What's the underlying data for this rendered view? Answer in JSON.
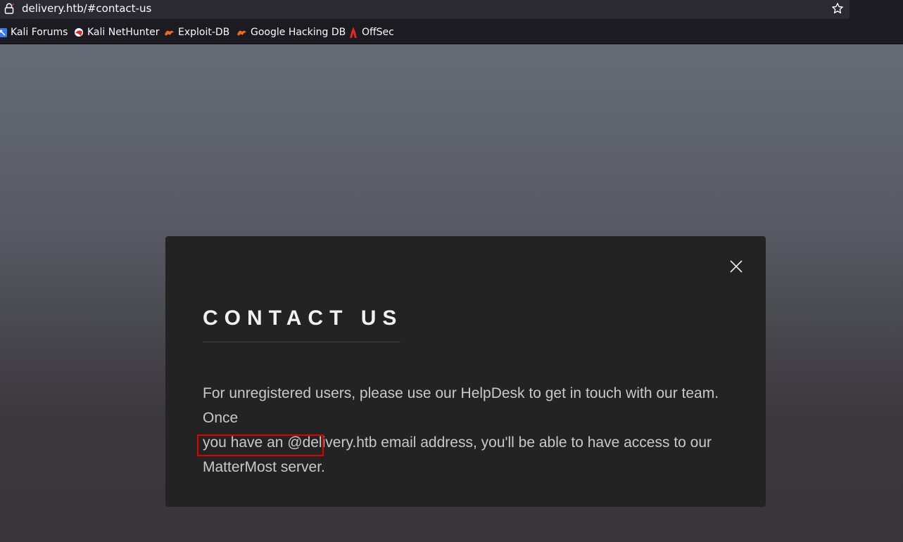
{
  "browser": {
    "url": "delivery.htb/#contact-us",
    "bookmarks": [
      {
        "label": "Kali Forums",
        "icon": "kali-forums-icon"
      },
      {
        "label": "Kali NetHunter",
        "icon": "kali-nethunter-icon"
      },
      {
        "label": "Exploit-DB",
        "icon": "exploit-db-icon"
      },
      {
        "label": "Google Hacking DB",
        "icon": "google-hacking-db-icon"
      },
      {
        "label": "OffSec",
        "icon": "offsec-icon"
      }
    ]
  },
  "modal": {
    "title": "CONTACT US",
    "body_line1": "For unregistered users, please use our HelpDesk to get in touch with our team. Once",
    "body_line2": "you have an @delivery.htb email address, you'll be able to have access to our",
    "body_line3": "MatterMost server."
  },
  "colors": {
    "annotation": "#e00000",
    "modal_background": "#232324"
  }
}
